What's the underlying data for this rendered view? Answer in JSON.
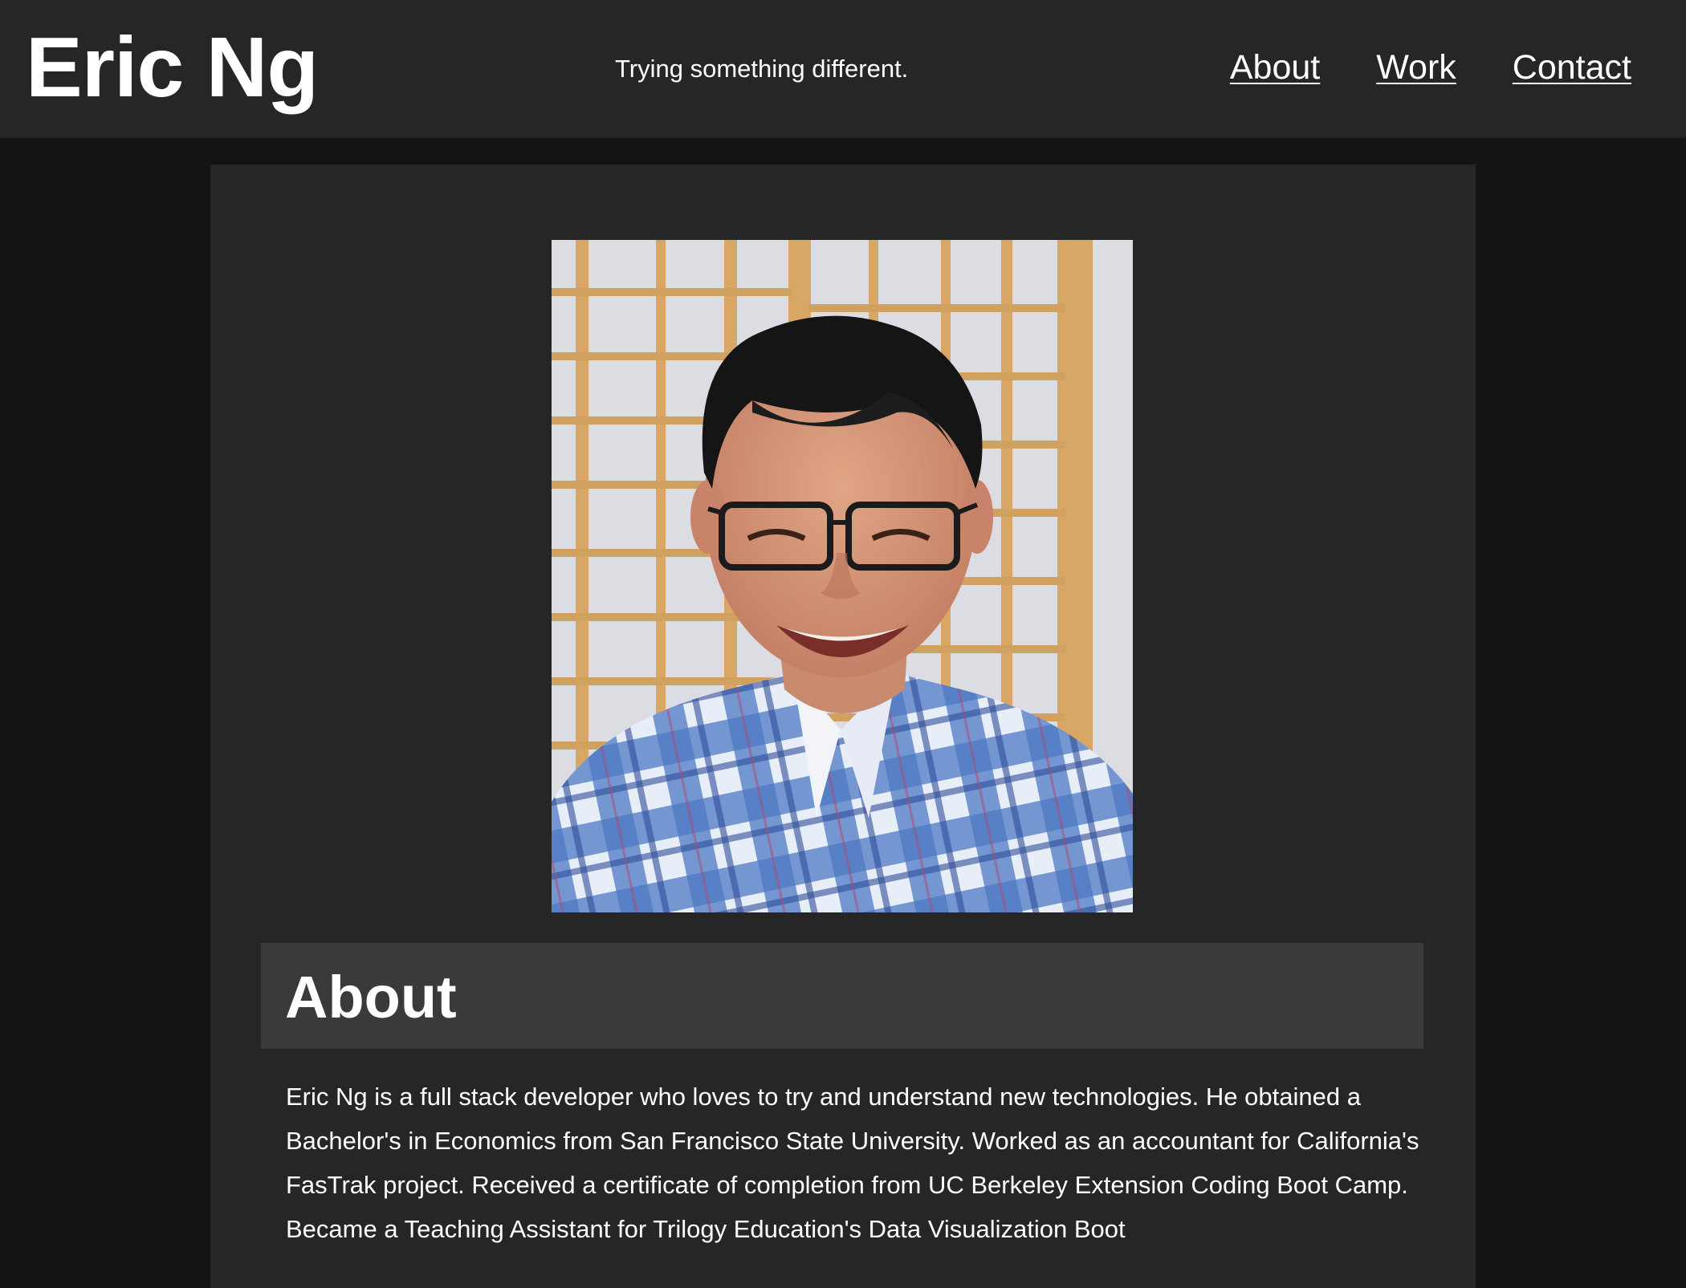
{
  "header": {
    "brand": "Eric Ng",
    "tagline": "Trying something different.",
    "nav": [
      {
        "label": "About"
      },
      {
        "label": "Work"
      },
      {
        "label": "Contact"
      }
    ]
  },
  "main": {
    "portrait_icon": "portrait-photo",
    "section_title": "About",
    "bio": "Eric Ng is a full stack developer who loves to try and understand new technologies. He obtained a Bachelor's in Economics from San Francisco State University. Worked as an accountant for California's FasTrak project. Received a certificate of completion from UC Berkeley Extension Coding Boot Camp. Became a Teaching Assistant for Trilogy Education's Data Visualization Boot"
  },
  "colors": {
    "page_bg": "#141414",
    "header_bg": "#262626",
    "panel_bg": "#262626",
    "section_head_bg": "#3a3a3a",
    "text": "#ffffff"
  }
}
